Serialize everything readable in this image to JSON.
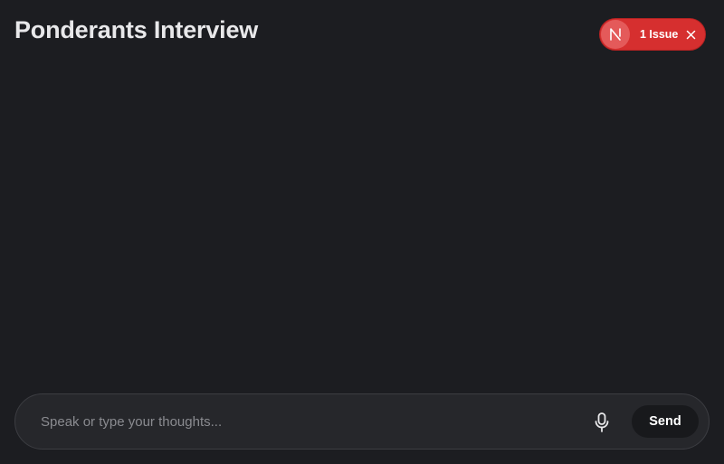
{
  "header": {
    "title": "Ponderants Interview"
  },
  "issues_badge": {
    "avatar_letter": "N",
    "label": "1 Issue",
    "avatar_icon": "nextjs-logo-icon",
    "close_icon": "close-icon",
    "color": "#d62f2f"
  },
  "composer": {
    "placeholder": "Speak or type your thoughts...",
    "value": "",
    "mic_icon": "microphone-icon",
    "send_label": "Send"
  },
  "theme": {
    "background": "#1c1d21",
    "composer_background": "#26272b",
    "accent": "#d62f2f"
  }
}
